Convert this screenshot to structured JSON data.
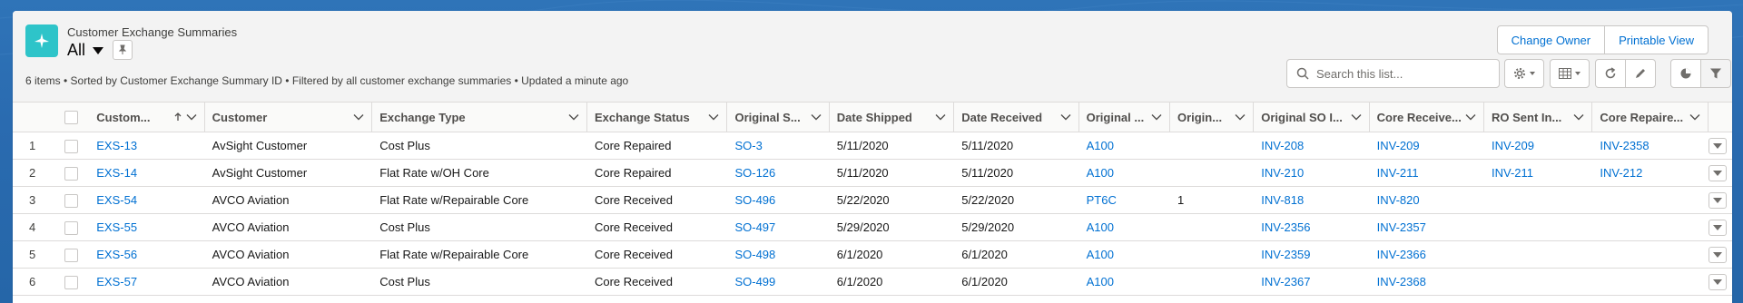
{
  "header": {
    "object_label": "Customer Exchange Summaries",
    "list_view_title": "All",
    "meta": "6 items • Sorted by Customer Exchange Summary ID • Filtered by all customer exchange summaries • Updated a minute ago",
    "buttons": {
      "change_owner": "Change Owner",
      "printable_view": "Printable View"
    },
    "search": {
      "placeholder": "Search this list..."
    }
  },
  "colors": {
    "brand_bg": "#2a6bb0",
    "object_icon": "#2ec4c9",
    "link": "#0070d2"
  },
  "icons": [
    "app-icon",
    "chevron-down-icon",
    "pin-icon",
    "search-icon",
    "gear-icon",
    "table-icon",
    "refresh-icon",
    "pencil-icon",
    "chart-icon",
    "filter-icon",
    "arrow-up-icon"
  ],
  "table": {
    "columns": [
      {
        "label": "Custom..."
      },
      {
        "label": "Customer"
      },
      {
        "label": "Exchange Type"
      },
      {
        "label": "Exchange Status"
      },
      {
        "label": "Original S..."
      },
      {
        "label": "Date Shipped"
      },
      {
        "label": "Date Received"
      },
      {
        "label": "Original ..."
      },
      {
        "label": "Origin..."
      },
      {
        "label": "Original SO I..."
      },
      {
        "label": "Core Receive..."
      },
      {
        "label": "RO Sent In..."
      },
      {
        "label": "Core Repaire..."
      }
    ],
    "rows": [
      {
        "n": "1",
        "id": "EXS-13",
        "customer": "AvSight Customer",
        "type": "Cost Plus",
        "status": "Core Repaired",
        "so": "SO-3",
        "shipped": "5/11/2020",
        "received": "5/11/2020",
        "part": "A100",
        "qty": "",
        "inv1": "INV-208",
        "inv2": "INV-209",
        "inv3": "INV-209",
        "inv4": "INV-2358"
      },
      {
        "n": "2",
        "id": "EXS-14",
        "customer": "AvSight Customer",
        "type": "Flat Rate w/OH Core",
        "status": "Core Repaired",
        "so": "SO-126",
        "shipped": "5/11/2020",
        "received": "5/11/2020",
        "part": "A100",
        "qty": "",
        "inv1": "INV-210",
        "inv2": "INV-211",
        "inv3": "INV-211",
        "inv4": "INV-212"
      },
      {
        "n": "3",
        "id": "EXS-54",
        "customer": "AVCO Aviation",
        "type": "Flat Rate w/Repairable Core",
        "status": "Core Received",
        "so": "SO-496",
        "shipped": "5/22/2020",
        "received": "5/22/2020",
        "part": "PT6C",
        "qty": "1",
        "inv1": "INV-818",
        "inv2": "INV-820",
        "inv3": "",
        "inv4": ""
      },
      {
        "n": "4",
        "id": "EXS-55",
        "customer": "AVCO Aviation",
        "type": "Cost Plus",
        "status": "Core Received",
        "so": "SO-497",
        "shipped": "5/29/2020",
        "received": "5/29/2020",
        "part": "A100",
        "qty": "",
        "inv1": "INV-2356",
        "inv2": "INV-2357",
        "inv3": "",
        "inv4": ""
      },
      {
        "n": "5",
        "id": "EXS-56",
        "customer": "AVCO Aviation",
        "type": "Flat Rate w/Repairable Core",
        "status": "Core Received",
        "so": "SO-498",
        "shipped": "6/1/2020",
        "received": "6/1/2020",
        "part": "A100",
        "qty": "",
        "inv1": "INV-2359",
        "inv2": "INV-2366",
        "inv3": "",
        "inv4": ""
      },
      {
        "n": "6",
        "id": "EXS-57",
        "customer": "AVCO Aviation",
        "type": "Cost Plus",
        "status": "Core Received",
        "so": "SO-499",
        "shipped": "6/1/2020",
        "received": "6/1/2020",
        "part": "A100",
        "qty": "",
        "inv1": "INV-2367",
        "inv2": "INV-2368",
        "inv3": "",
        "inv4": ""
      }
    ]
  }
}
